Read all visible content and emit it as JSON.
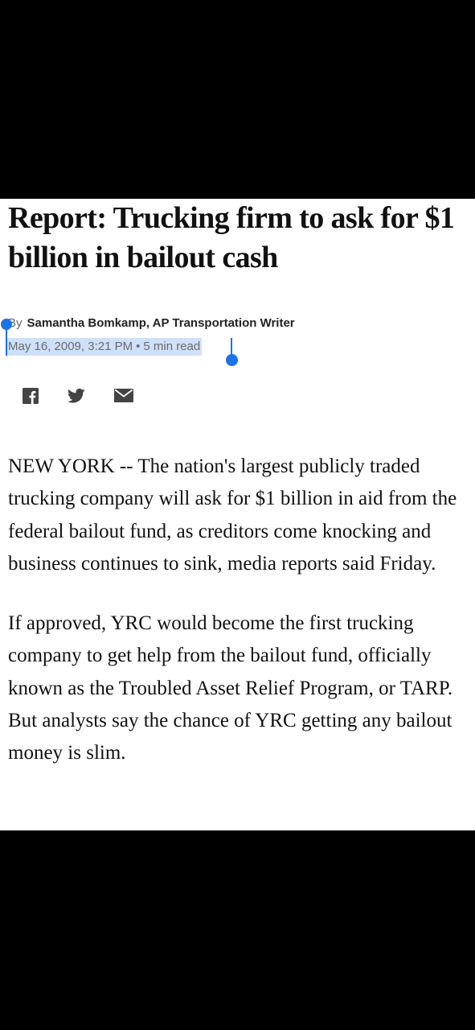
{
  "article": {
    "headline": "Report: Trucking firm to ask for $1 billion in bailout cash",
    "byline_prefix": "By",
    "author": "Samantha Bomkamp, AP Transportation Writer",
    "date": "May 16, 2009, 3:21 PM",
    "separator": "•",
    "read_time": "5 min read",
    "paragraphs": [
      "NEW YORK -- The nation's largest publicly traded trucking company will ask for $1 billion in aid from the federal bailout fund, as creditors come knocking and business continues to sink, media reports said Friday.",
      "If approved, YRC would become the first trucking company to get help from the bailout fund, officially known as the Troubled Asset Relief Program, or TARP. But analysts say the chance of YRC getting any bailout money is slim."
    ]
  },
  "share": {
    "icons": [
      "facebook-icon",
      "twitter-icon",
      "email-icon"
    ],
    "icon_color": "#444444"
  },
  "colors": {
    "selection_highlight": "#cfe0fb",
    "selection_handle": "#1a73e8"
  }
}
